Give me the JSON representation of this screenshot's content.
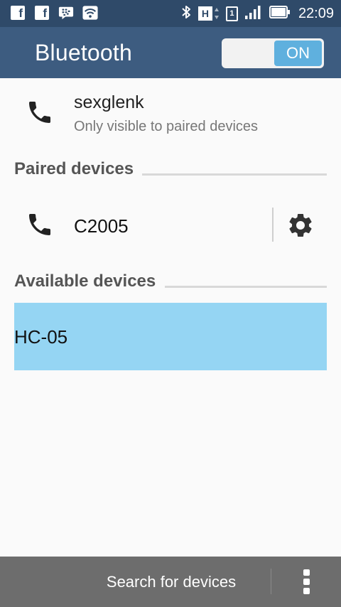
{
  "status_bar": {
    "left_icons": [
      "facebook-icon",
      "facebook-icon",
      "bbm-icon",
      "wifi-icon"
    ],
    "right_icons": [
      "bluetooth-icon",
      "network-h-icon",
      "sim-1-icon",
      "signal-icon",
      "battery-icon"
    ],
    "network_label": "H",
    "sim_label": "1",
    "facebook_letter": "f",
    "time": "22:09"
  },
  "app_bar": {
    "title": "Bluetooth",
    "toggle_label": "ON",
    "toggle_state": "on"
  },
  "this_device": {
    "name": "sexglenk",
    "visibility": "Only visible to paired devices",
    "icon": "phone-icon"
  },
  "paired_section": {
    "title": "Paired devices",
    "devices": [
      {
        "name": "C2005",
        "icon": "phone-icon",
        "action_icon": "gear-icon"
      }
    ]
  },
  "available_section": {
    "title": "Available devices",
    "devices": [
      {
        "name": "HC-05",
        "selected": true
      }
    ]
  },
  "bottom_bar": {
    "search_label": "Search for devices",
    "menu_icon": "overflow-menu-icon"
  },
  "colors": {
    "status_bar_bg": "#2f4a69",
    "app_bar_bg": "#3d5c80",
    "toggle_accent": "#5fb0de",
    "selected_row_bg": "#95d5f3",
    "bottom_bar_bg": "#6d6d6d"
  }
}
